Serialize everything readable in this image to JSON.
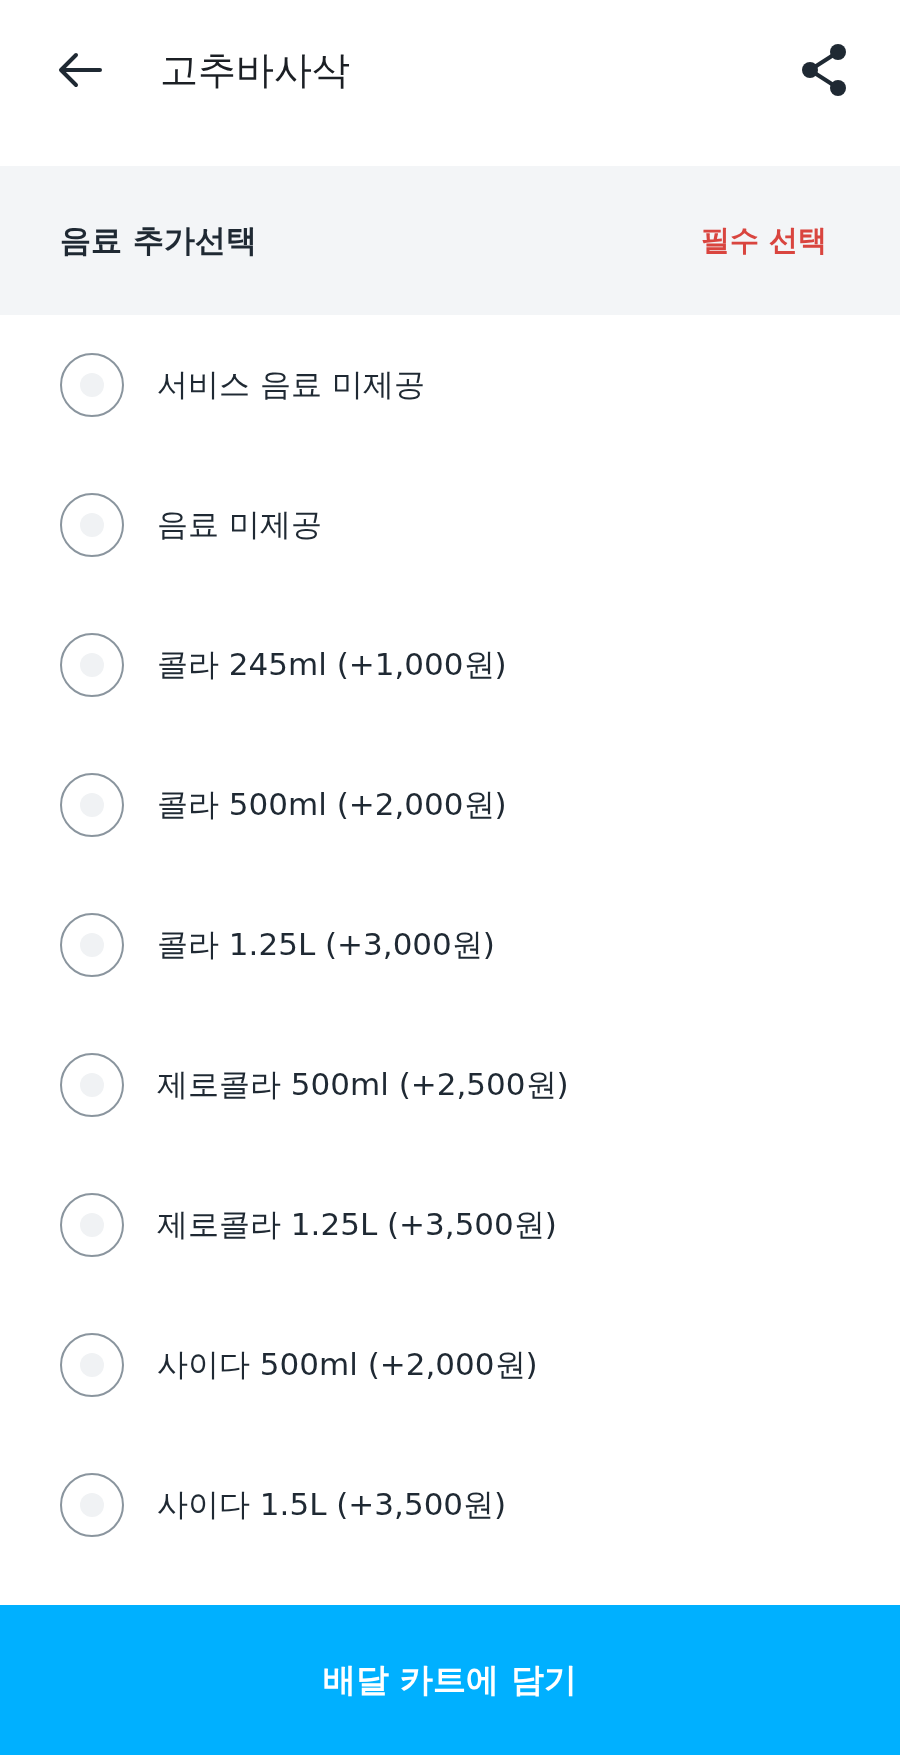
{
  "header": {
    "title": "고추바사삭"
  },
  "section": {
    "title": "음료 추가선택",
    "requirement": "필수 선택"
  },
  "options": [
    {
      "label": "서비스 음료 미제공",
      "selected": false
    },
    {
      "label": "음료 미제공",
      "selected": false
    },
    {
      "label": "콜라 245ml (+1,000원)",
      "selected": false
    },
    {
      "label": "콜라 500ml (+2,000원)",
      "selected": false
    },
    {
      "label": "콜라 1.25L (+3,000원)",
      "selected": false
    },
    {
      "label": "제로콜라 500ml (+2,500원)",
      "selected": false
    },
    {
      "label": "제로콜라 1.25L (+3,500원)",
      "selected": false
    },
    {
      "label": "사이다 500ml (+2,000원)",
      "selected": false
    },
    {
      "label": "사이다 1.5L (+3,500원)",
      "selected": false
    }
  ],
  "cart_button": {
    "label": "배달 카트에 담기"
  }
}
